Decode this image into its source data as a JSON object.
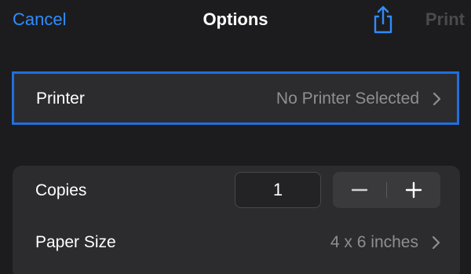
{
  "navbar": {
    "cancel_label": "Cancel",
    "title": "Options",
    "share_icon": "share-icon",
    "print_label": "Print"
  },
  "printer": {
    "label": "Printer",
    "value": "No Printer Selected",
    "chevron_icon": "chevron-right-icon"
  },
  "options": {
    "copies": {
      "label": "Copies",
      "value": "1",
      "decrement_icon": "minus-icon",
      "increment_icon": "plus-icon"
    },
    "paper_size": {
      "label": "Paper Size",
      "value": "4 x 6 inches",
      "chevron_icon": "chevron-right-icon"
    }
  },
  "colors": {
    "accent": "#2f8cff",
    "focus_border": "#1f6fe0",
    "background": "#1c1c1e",
    "card": "#2c2c2e",
    "secondary_text": "#8e8e93",
    "disabled_text": "#4a4a4e"
  }
}
